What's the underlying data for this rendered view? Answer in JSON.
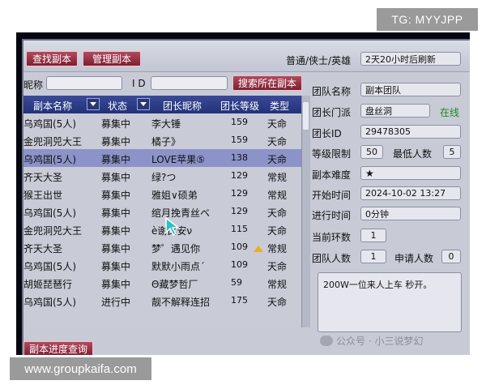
{
  "watermarks": {
    "top_tag": "TG: MYYJPP",
    "bottom_url": "www.groupkaifa.com",
    "wechat": "公众号 · 小三说梦幻"
  },
  "toolbar": {
    "find_label": "查找副本",
    "manage_label": "管理副本",
    "mode_label": "普通/侠士/英雄",
    "refresh_text": "2天20小时后刷新"
  },
  "search": {
    "nick_label": "昵称",
    "id_label": "I D",
    "search_button": "搜索所在副本"
  },
  "table": {
    "headers": [
      "副本名称",
      "状态",
      "团长昵称",
      "团长等级",
      "类型"
    ],
    "rows": [
      {
        "name": "乌鸡国(5人)",
        "status": "募集中",
        "leader": "李大锤",
        "level": "159",
        "type": "天命"
      },
      {
        "name": "金兜洞兕大王",
        "status": "募集中",
        "leader": "橘子》",
        "level": "159",
        "type": "天命"
      },
      {
        "name": "乌鸡国(5人)",
        "status": "募集中",
        "leader": "LOVE苹果⑤",
        "level": "138",
        "type": "天命"
      },
      {
        "name": "齐天大圣",
        "status": "募集中",
        "leader": "绿?つ",
        "level": "129",
        "type": "常规"
      },
      {
        "name": "猴王出世",
        "status": "募集中",
        "leader": "雅姐∨硕弟",
        "level": "129",
        "type": "常规"
      },
      {
        "name": "乌鸡国(5人)",
        "status": "募集中",
        "leader": "绾月挽青丝ベ",
        "level": "129",
        "type": "天命"
      },
      {
        "name": "金兜洞兕大王",
        "status": "募集中",
        "leader": "è谢比安ν",
        "level": "115",
        "type": "天命"
      },
      {
        "name": "齐天大圣",
        "status": "募集中",
        "leader": "梦゜遇见你",
        "level": "109",
        "type": "常规"
      },
      {
        "name": "乌鸡国(5人)",
        "status": "募集中",
        "leader": "默默小雨点´",
        "level": "109",
        "type": "天命"
      },
      {
        "name": "胡姬琵琶行",
        "status": "募集中",
        "leader": "Θ藏梦哲厂",
        "level": "59",
        "type": "常规"
      },
      {
        "name": "乌鸡国(5人)",
        "status": "进行中",
        "leader": "靓不解释连招",
        "level": "175",
        "type": "天命"
      }
    ]
  },
  "progress_button": "副本进度查询",
  "details": {
    "team_name_label": "团队名称",
    "team_name": "副本团队",
    "sect_label": "团长门派",
    "sect": "盘丝洞",
    "online": "在线",
    "leader_id_label": "团长ID",
    "leader_id": "29478305",
    "level_limit_label": "等级限制",
    "level_limit": "50",
    "min_people_label": "最低人数",
    "min_people": "5",
    "difficulty_label": "副本难度",
    "difficulty": "★",
    "start_label": "开始时间",
    "start": "2024-10-02 13:27",
    "elapsed_label": "进行时间",
    "elapsed": "0分钟",
    "round_label": "当前环数",
    "round": "1",
    "team_count_label": "团队人数",
    "team_count": "1",
    "applicants_label": "申请人数",
    "applicants": "0",
    "note": "200W一位来人上车 秒开。"
  },
  "colors": {
    "header_blue": "#2a3a8a",
    "button_red": "#8e2a3c",
    "online_green": "#1a8a1a",
    "selected_row": "#8c93c9"
  }
}
